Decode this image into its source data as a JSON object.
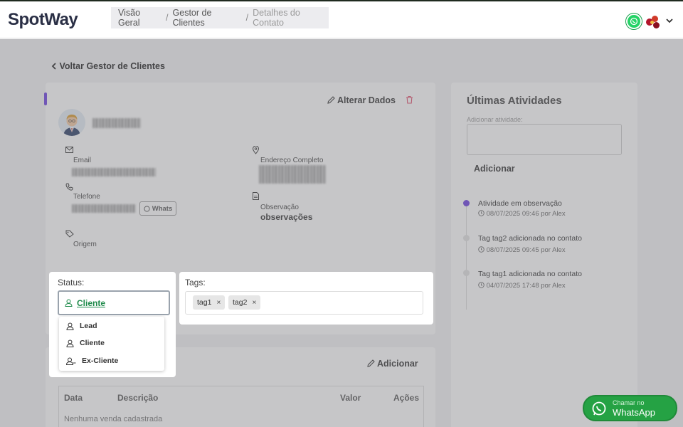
{
  "app": {
    "logo": "SpotWay"
  },
  "breadcrumb": {
    "item1": "Visão Geral",
    "item2": "Gestor de Clientes",
    "current": "Detalhes do Contato",
    "sep": "/"
  },
  "back": {
    "label": "Voltar Gestor de Clientes"
  },
  "contact": {
    "alter_label": "Alterar Dados",
    "email_label": "Email",
    "address_label": "Endereço Completo",
    "phone_label": "Telefone",
    "whats_label": "Whats",
    "obs_label": "Observação",
    "obs_value": "observações",
    "origin_label": "Origem"
  },
  "status": {
    "label": "Status:",
    "selected": "Cliente",
    "options": [
      "Lead",
      "Cliente",
      "Ex-Cliente"
    ]
  },
  "tags": {
    "label": "Tags:",
    "items": [
      "tag1",
      "tag2"
    ],
    "remove_glyph": "×"
  },
  "sales": {
    "add_label": "Adicionar",
    "columns": [
      "Data",
      "Descrição",
      "Valor",
      "Ações"
    ],
    "empty": "Nenhuma venda cadastrada"
  },
  "activities": {
    "title": "Últimas Atividades",
    "input_label": "Adicionar atividade:",
    "add_label": "Adicionar",
    "items": [
      {
        "text": "Atividade em observação",
        "meta": "08/07/2025 09:46 por Alex"
      },
      {
        "text": "Tag tag2 adicionada no contato",
        "meta": "08/07/2025 09:45 por Alex"
      },
      {
        "text": "Tag tag1 adicionada no contato",
        "meta": "04/07/2025 17:48 por Alex"
      }
    ]
  },
  "whatsapp_float": {
    "line1": "Chamar no",
    "line2": "WhatsApp"
  },
  "colors": {
    "accent": "#6b3fe0",
    "whatsapp": "#25d366",
    "status_green": "#1e8a4a",
    "delete": "#e04a6a"
  }
}
